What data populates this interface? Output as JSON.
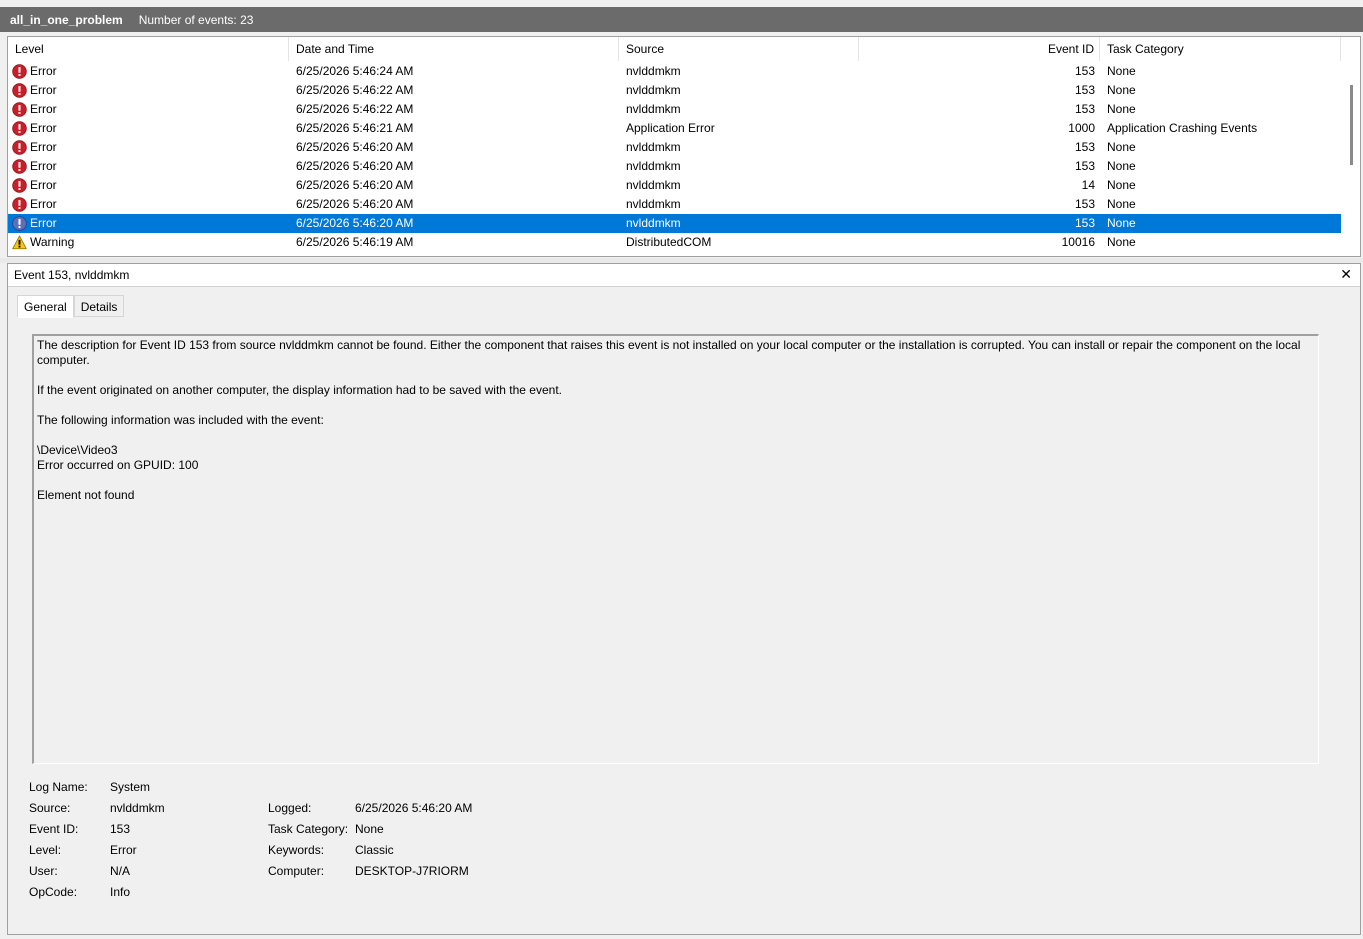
{
  "titlebar": {
    "name": "all_in_one_problem",
    "count": "Number of events: 23"
  },
  "columns": {
    "level": "Level",
    "date": "Date and Time",
    "source": "Source",
    "event_id": "Event ID",
    "task": "Task Category"
  },
  "rows": [
    {
      "level": "Error",
      "date": "6/25/2026 5:46:24 AM",
      "source": "nvlddmkm",
      "event_id": "153",
      "task": "None",
      "icon": "error-icon"
    },
    {
      "level": "Error",
      "date": "6/25/2026 5:46:22 AM",
      "source": "nvlddmkm",
      "event_id": "153",
      "task": "None",
      "icon": "error-icon"
    },
    {
      "level": "Error",
      "date": "6/25/2026 5:46:22 AM",
      "source": "nvlddmkm",
      "event_id": "153",
      "task": "None",
      "icon": "error-icon"
    },
    {
      "level": "Error",
      "date": "6/25/2026 5:46:21 AM",
      "source": "Application Error",
      "event_id": "1000",
      "task": "Application Crashing Events",
      "icon": "error-icon"
    },
    {
      "level": "Error",
      "date": "6/25/2026 5:46:20 AM",
      "source": "nvlddmkm",
      "event_id": "153",
      "task": "None",
      "icon": "error-icon"
    },
    {
      "level": "Error",
      "date": "6/25/2026 5:46:20 AM",
      "source": "nvlddmkm",
      "event_id": "153",
      "task": "None",
      "icon": "error-icon"
    },
    {
      "level": "Error",
      "date": "6/25/2026 5:46:20 AM",
      "source": "nvlddmkm",
      "event_id": "14",
      "task": "None",
      "icon": "error-icon"
    },
    {
      "level": "Error",
      "date": "6/25/2026 5:46:20 AM",
      "source": "nvlddmkm",
      "event_id": "153",
      "task": "None",
      "icon": "error-icon"
    },
    {
      "level": "Error",
      "date": "6/25/2026 5:46:20 AM",
      "source": "nvlddmkm",
      "event_id": "153",
      "task": "None",
      "icon": "error-icon",
      "selected": true
    },
    {
      "level": "Warning",
      "date": "6/25/2026 5:46:19 AM",
      "source": "DistributedCOM",
      "event_id": "10016",
      "task": "None",
      "icon": "warning-icon"
    }
  ],
  "detail": {
    "title": "Event 153, nvlddmkm",
    "tabs": [
      "General",
      "Details"
    ],
    "description": {
      "p1": "The description for Event ID 153 from source nvlddmkm cannot be found. Either the component that raises this event is not installed on your local computer or the installation is corrupted. You can install or repair the component on the local computer.",
      "p2": "If the event originated on another computer, the display information had to be saved with the event.",
      "p3": "The following information was included with the event:",
      "p4a": "\\Device\\Video3",
      "p4b": "Error occurred on GPUID: 100",
      "p5": "Element not found"
    },
    "props": {
      "log_name_label": "Log Name:",
      "log_name": "System",
      "source_label": "Source:",
      "source": "nvlddmkm",
      "logged_label": "Logged:",
      "logged": "6/25/2026 5:46:20 AM",
      "event_id_label": "Event ID:",
      "event_id": "153",
      "task_label": "Task Category:",
      "task": "None",
      "level_label": "Level:",
      "level": "Error",
      "keywords_label": "Keywords:",
      "keywords": "Classic",
      "user_label": "User:",
      "user": "N/A",
      "computer_label": "Computer:",
      "computer": "DESKTOP-J7RIORM",
      "opcode_label": "OpCode:",
      "opcode": "Info"
    }
  },
  "colors": {
    "titlebar": "#6b6b6b",
    "selection": "#0078d7",
    "error": "#d1242f",
    "warning": "#f2c811"
  }
}
